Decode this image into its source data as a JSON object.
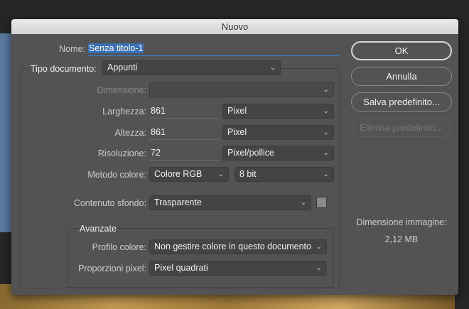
{
  "dialog": {
    "title": "Nuovo"
  },
  "name": {
    "label": "Nome:",
    "value": "Senza titolo-1"
  },
  "doc_type": {
    "label": "Tipo documento:",
    "value": "Appunti"
  },
  "size": {
    "label": "Dimensione:",
    "value": ""
  },
  "width": {
    "label": "Larghezza:",
    "value": "861",
    "unit": "Pixel"
  },
  "height": {
    "label": "Altezza:",
    "value": "861",
    "unit": "Pixel"
  },
  "resolution": {
    "label": "Risoluzione:",
    "value": "72",
    "unit": "Pixel/pollice"
  },
  "color_mode": {
    "label": "Metodo colore:",
    "value": "Colore RGB",
    "depth": "8 bit"
  },
  "background": {
    "label": "Contenuto sfondo:",
    "value": "Trasparente",
    "swatch": "#8a8a8a"
  },
  "advanced": {
    "title": "Avanzate",
    "profile_label": "Profilo colore:",
    "profile_value": "Non gestire colore in questo documento",
    "aspect_label": "Proporzioni pixel:",
    "aspect_value": "Pixel quadrati"
  },
  "buttons": {
    "ok": "OK",
    "cancel": "Annulla",
    "save_preset": "Salva predefinito...",
    "delete_preset": "Elimina predefinito..."
  },
  "image_size": {
    "label": "Dimensione immagine:",
    "value": "2,12 MB"
  }
}
